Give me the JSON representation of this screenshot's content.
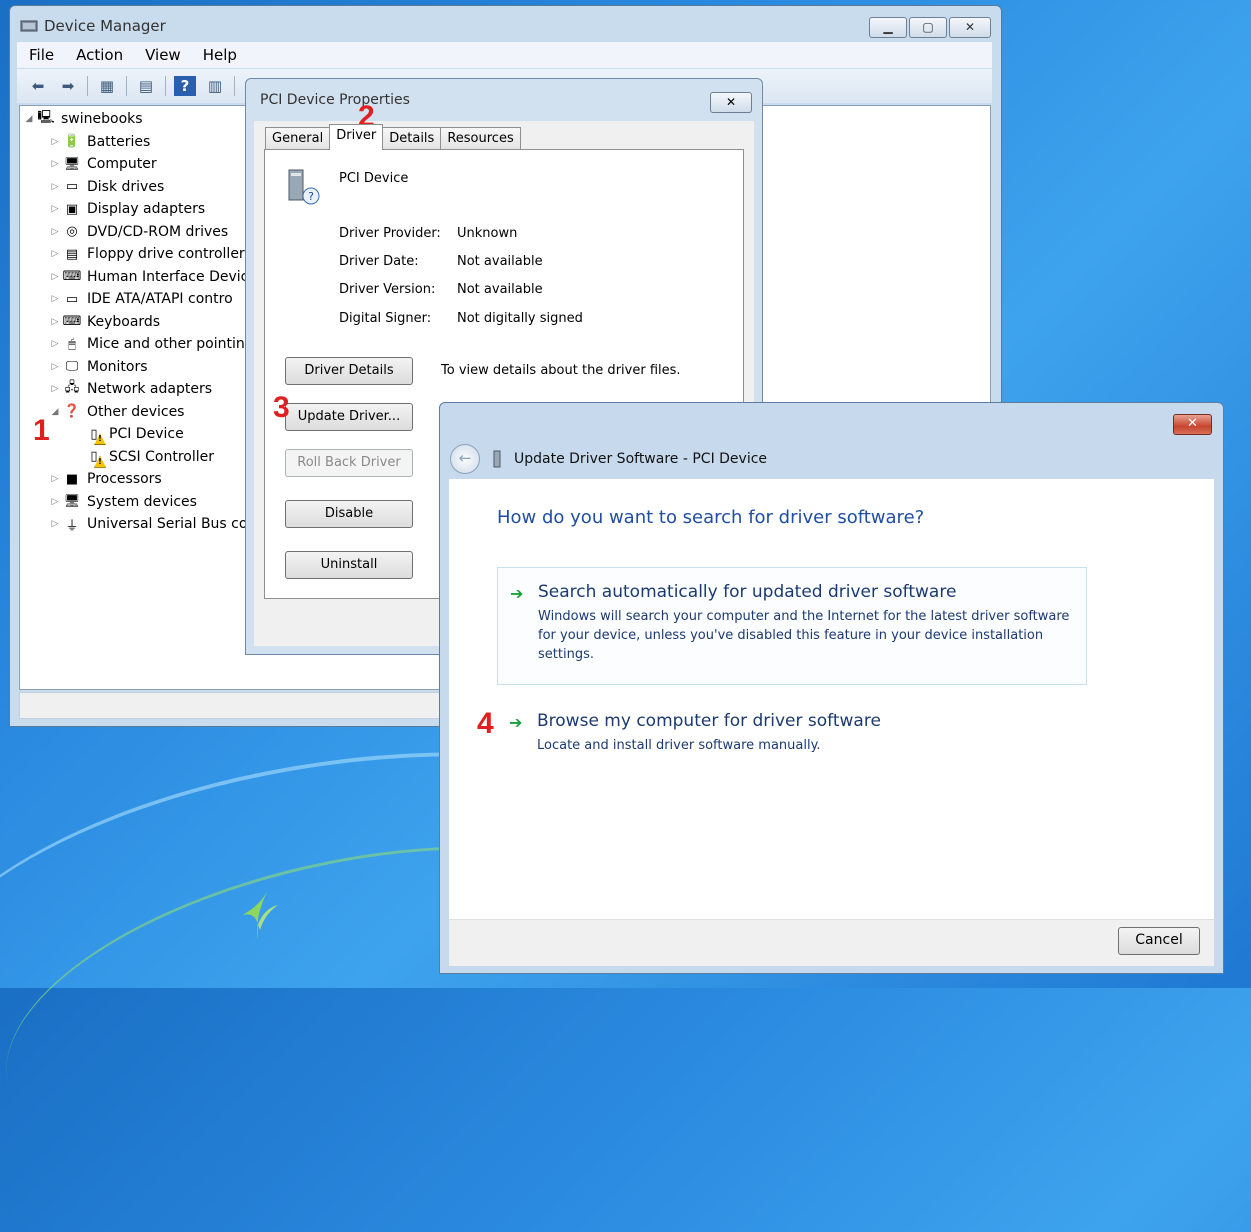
{
  "device_manager": {
    "title": "Device Manager",
    "menu": [
      "File",
      "Action",
      "View",
      "Help"
    ],
    "tree": {
      "root": "swinebooks",
      "categories": [
        {
          "label": "Batteries",
          "icon": "battery-icon",
          "expanded": false
        },
        {
          "label": "Computer",
          "icon": "computer-icon",
          "expanded": false
        },
        {
          "label": "Disk drives",
          "icon": "disk-drive-icon",
          "expanded": false
        },
        {
          "label": "Display adapters",
          "icon": "display-adapter-icon",
          "expanded": false
        },
        {
          "label": "DVD/CD-ROM drives",
          "icon": "dvd-drive-icon",
          "expanded": false
        },
        {
          "label": "Floppy drive controller",
          "icon": "floppy-icon",
          "expanded": false
        },
        {
          "label": "Human Interface Devic",
          "icon": "hid-icon",
          "expanded": false
        },
        {
          "label": "IDE ATA/ATAPI contro",
          "icon": "ide-controller-icon",
          "expanded": false
        },
        {
          "label": "Keyboards",
          "icon": "keyboard-icon",
          "expanded": false
        },
        {
          "label": "Mice and other pointin",
          "icon": "mouse-icon",
          "expanded": false
        },
        {
          "label": "Monitors",
          "icon": "monitor-icon",
          "expanded": false
        },
        {
          "label": "Network adapters",
          "icon": "network-icon",
          "expanded": false
        },
        {
          "label": "Other devices",
          "icon": "unknown-device-icon",
          "expanded": true,
          "children": [
            {
              "label": "PCI Device",
              "icon": "warning-device-icon"
            },
            {
              "label": "SCSI Controller",
              "icon": "warning-device-icon"
            }
          ]
        },
        {
          "label": "Processors",
          "icon": "processor-icon",
          "expanded": false
        },
        {
          "label": "System devices",
          "icon": "system-device-icon",
          "expanded": false
        },
        {
          "label": "Universal Serial Bus co",
          "icon": "usb-icon",
          "expanded": false
        }
      ]
    }
  },
  "properties": {
    "title": "PCI Device Properties",
    "tabs": [
      "General",
      "Driver",
      "Details",
      "Resources"
    ],
    "active_tab": "Driver",
    "device_name": "PCI Device",
    "fields": [
      {
        "key": "Driver Provider:",
        "value": "Unknown"
      },
      {
        "key": "Driver Date:",
        "value": "Not available"
      },
      {
        "key": "Driver Version:",
        "value": "Not available"
      },
      {
        "key": "Digital Signer:",
        "value": "Not digitally signed"
      }
    ],
    "buttons": {
      "driver_details": "Driver Details",
      "driver_details_desc": "To view details about the driver files.",
      "update_driver": "Update Driver...",
      "roll_back": "Roll Back Driver",
      "disable": "Disable",
      "uninstall": "Uninstall"
    }
  },
  "wizard": {
    "title": "Update Driver Software - PCI Device",
    "question": "How do you want to search for driver software?",
    "option_auto": {
      "title": "Search automatically for updated driver software",
      "desc": "Windows will search your computer and the Internet for the latest driver software for your device, unless you've disabled this feature in your device installation settings."
    },
    "option_browse": {
      "title": "Browse my computer for driver software",
      "desc": "Locate and install driver software manually."
    },
    "cancel": "Cancel"
  },
  "step_labels": [
    "1",
    "2",
    "3",
    "4"
  ],
  "colors": {
    "step": "#e02020",
    "link_blue": "#1f4ea3",
    "arrow_green": "#17a23b"
  }
}
